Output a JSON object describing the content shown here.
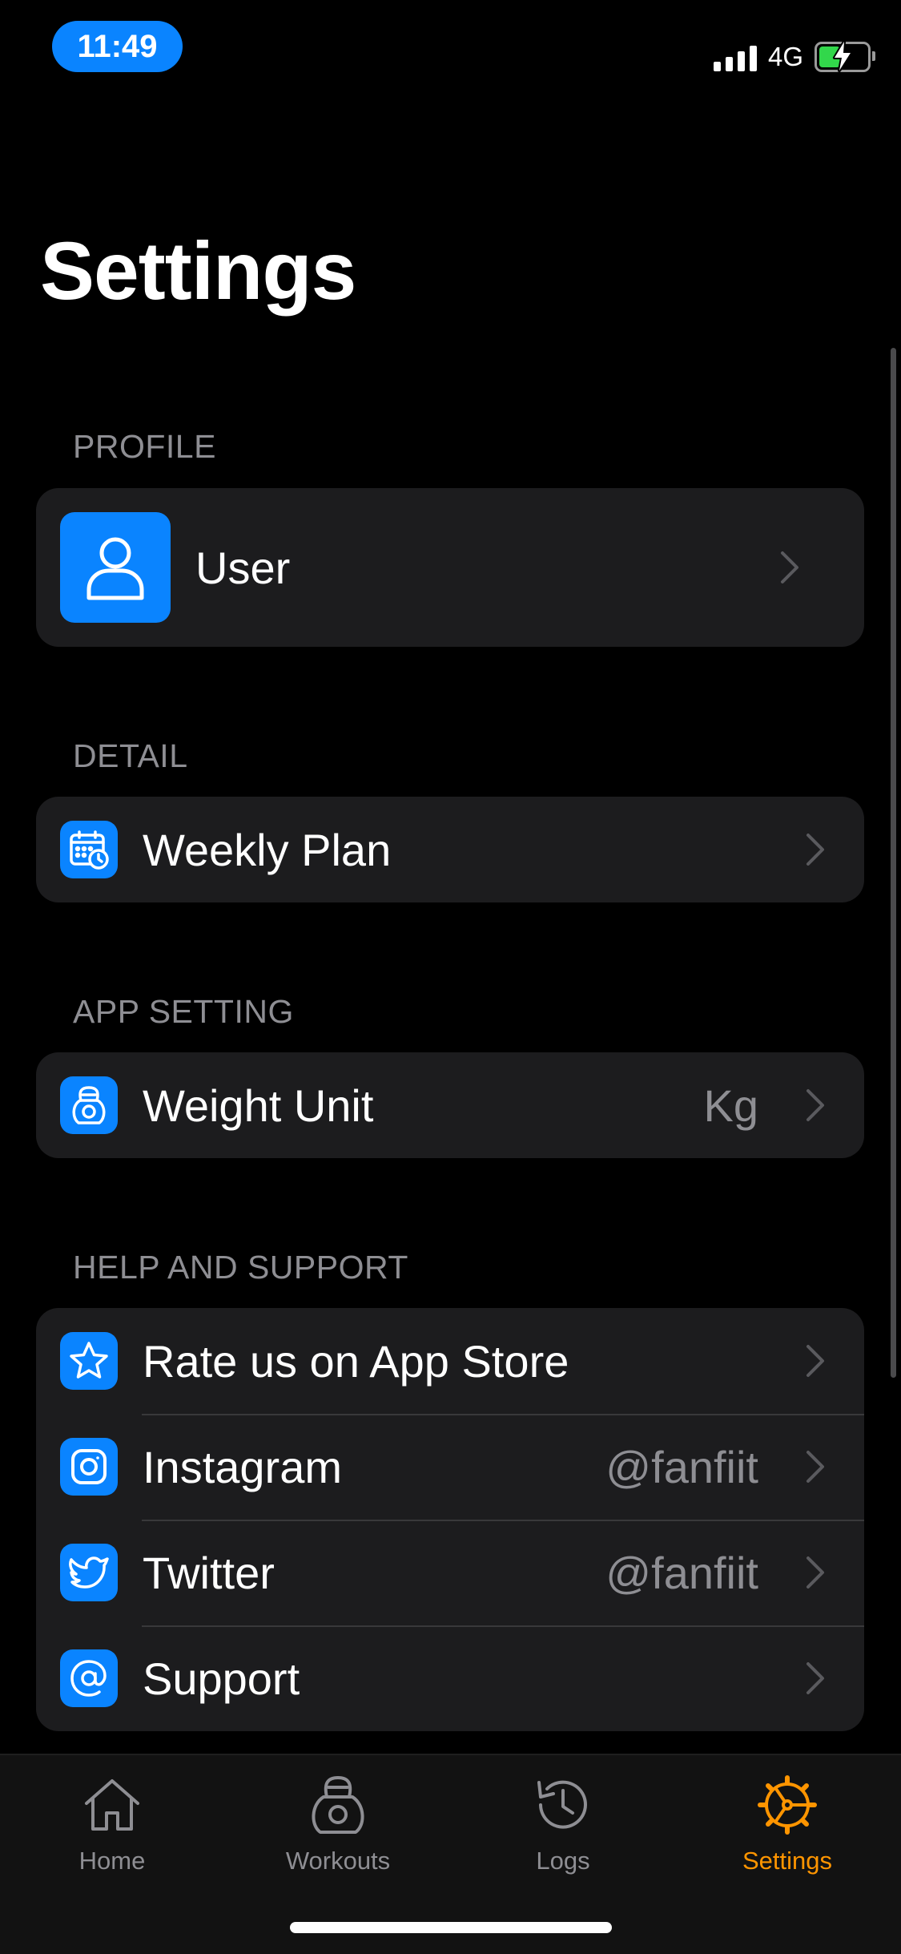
{
  "status_bar": {
    "time": "11:49",
    "network": "4G"
  },
  "page_title": "Settings",
  "sections": {
    "profile": {
      "header": "PROFILE",
      "user_label": "User"
    },
    "detail": {
      "header": "DETAIL",
      "weekly_plan_label": "Weekly Plan"
    },
    "app_setting": {
      "header": "APP SETTING",
      "weight_unit_label": "Weight Unit",
      "weight_unit_value": "Kg"
    },
    "help_support": {
      "header": "HELP AND SUPPORT",
      "rate_label": "Rate us on App Store",
      "instagram_label": "Instagram",
      "instagram_value": "@fanfiit",
      "twitter_label": "Twitter",
      "twitter_value": "@fanfiit",
      "support_label": "Support"
    }
  },
  "tab_bar": {
    "home": "Home",
    "workouts": "Workouts",
    "logs": "Logs",
    "settings": "Settings",
    "active": "settings"
  },
  "colors": {
    "accent": "#0a84ff",
    "active_tab": "#ff9500",
    "card": "#1c1c1e",
    "background": "#000000"
  },
  "icons": [
    "user-icon",
    "calendar-icon",
    "kettlebell-icon",
    "star-icon",
    "instagram-icon",
    "twitter-icon",
    "at-sign-icon",
    "home-icon",
    "workouts-icon",
    "logs-icon",
    "settings-icon"
  ]
}
